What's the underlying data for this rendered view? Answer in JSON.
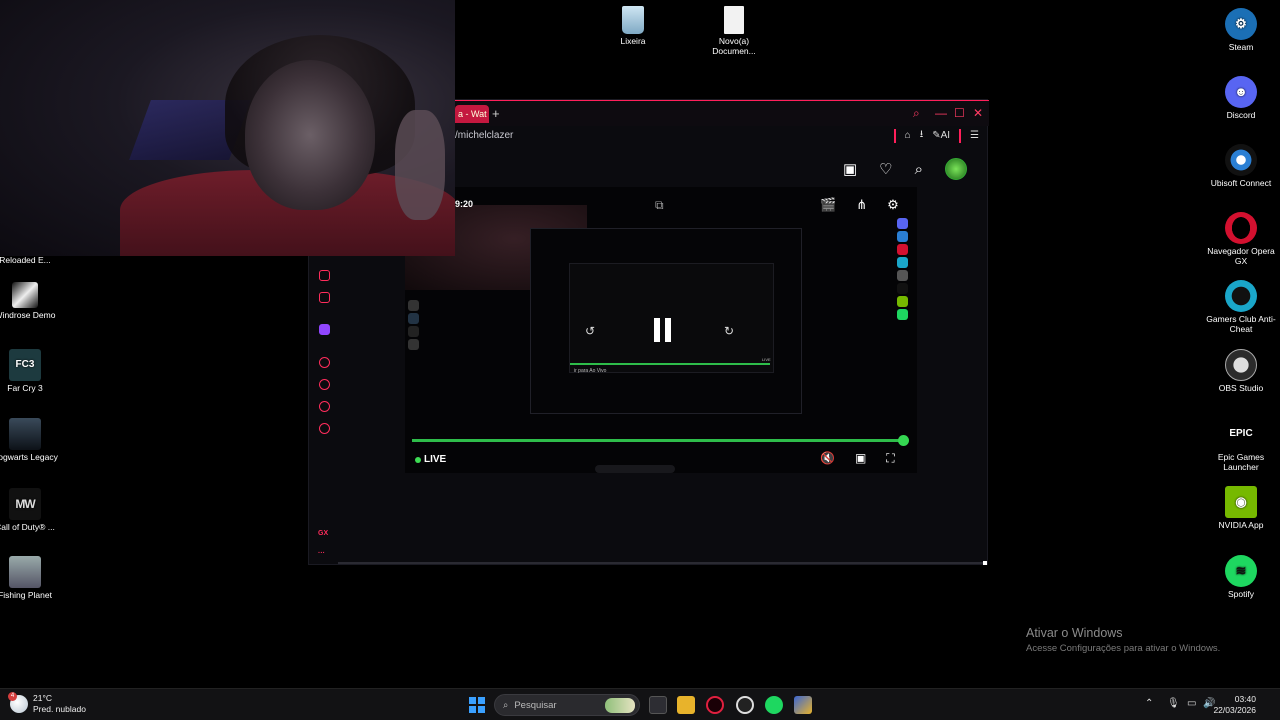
{
  "desktop": {
    "icons_top": [
      {
        "name": "recycle-bin",
        "label": "Lixeira"
      },
      {
        "name": "new-document",
        "label": "Novo(a) Documen..."
      }
    ],
    "icons_left": [
      {
        "name": "reloaded",
        "label": "Reloaded E..."
      },
      {
        "name": "windrose",
        "label": "Windrose Demo"
      },
      {
        "name": "farcry3",
        "label": "Far Cry 3",
        "glyph": "FC3"
      },
      {
        "name": "hogwarts",
        "label": "Hogwarts Legacy"
      },
      {
        "name": "cod",
        "label": "Call of Duty® ...",
        "glyph": "MW"
      },
      {
        "name": "fishing",
        "label": "Fishing Planet"
      }
    ],
    "icons_right": [
      {
        "name": "steam",
        "label": "Steam",
        "color": "#1b6fb5"
      },
      {
        "name": "discord",
        "label": "Discord",
        "color": "#5865f2"
      },
      {
        "name": "ubisoft",
        "label": "Ubisoft Connect",
        "color": "#2a7fd4"
      },
      {
        "name": "opera-gx",
        "label": "Navegador Opera GX",
        "color": "#d3102f"
      },
      {
        "name": "gamers-club",
        "label": "Gamers Club Anti-Cheat",
        "color": "#1aa6c9"
      },
      {
        "name": "obs",
        "label": "OBS Studio",
        "color": "#2b2b2b"
      },
      {
        "name": "epic",
        "label": "Epic Games Launcher",
        "color": "#000000",
        "glyph": "EPIC"
      },
      {
        "name": "nvidia",
        "label": "NVIDIA App",
        "color": "#76b900"
      },
      {
        "name": "spotify",
        "label": "Spotify",
        "color": "#1ed760"
      }
    ]
  },
  "browser": {
    "tab_title": "a - Wat",
    "new_tab": "+",
    "url": "/michelclazer",
    "ai_label": "AI"
  },
  "player": {
    "time": "9:20",
    "live_label": "LIVE",
    "progress": 0.995,
    "nested_live_text": "ir para Ao Vivo",
    "nested_live_badge": "LIVE"
  },
  "watermark": {
    "title": "Ativar o Windows",
    "subtitle": "Acesse Configurações para ativar o Windows."
  },
  "taskbar": {
    "temperature": "21°C",
    "weather": "Pred. nublado",
    "weather_badge": "4",
    "search_placeholder": "Pesquisar",
    "time": "03:40",
    "date": "22/03/2026"
  },
  "colors": {
    "accent": "#ff1f5a",
    "live_green": "#2ebd4a"
  }
}
